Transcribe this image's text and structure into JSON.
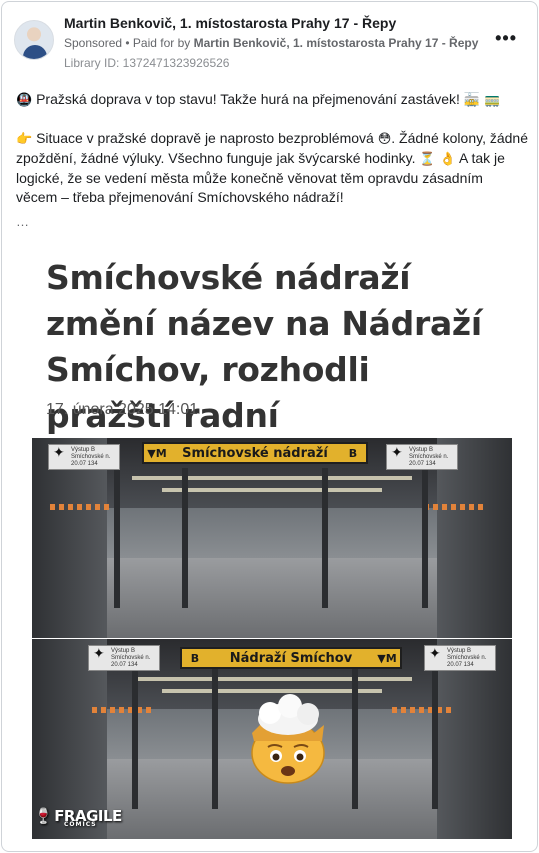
{
  "post": {
    "page_name": "Martin Benkovič, 1. místostarosta Prahy 17 - Řepy",
    "sponsored_label": "Sponsored",
    "separator": " • ",
    "paid_for_prefix": "Paid for by ",
    "paid_for_by": "Martin Benkovič, 1. místostarosta Prahy 17 - Řepy",
    "library_id": "Library ID: 1372471323926526",
    "more_label": "•••",
    "paragraph_1": "Pražská doprava v top stavu! Takže hurá na přejmenování zastávek!",
    "paragraph_1_emoji_start": "🚇",
    "paragraph_1_emoji_end": "🚋 🚃",
    "paragraph_2_a": "Situace v pražské dopravě je naprosto bezproblémová",
    "paragraph_2_b": ". Žádné kolony, žádné zpoždění, žádné výluky. Všechno funguje jak švýcarské hodinky.",
    "paragraph_2_c": " A tak je logické, že se vedení města může konečně věnovat těm opravdu zásadním věcem – třeba přejmenování Smíchovského nádraží!",
    "paragraph_2_emoji_start": "👉",
    "paragraph_2_emoji_mid": "😳",
    "paragraph_2_emoji_end": "⏳ 👌",
    "see_more": "…"
  },
  "media": {
    "headline": "Smíchovské nádraží změní název na Nádraží Smíchov, rozhodli pražští radní",
    "date": "17. února 2025  14:01",
    "top_sign": "Smíchovské nádraží",
    "top_sign_left": "▼M",
    "top_sign_right": "B",
    "bottom_sign": "Nádraží Smíchov",
    "bottom_sign_left": "B",
    "bottom_sign_right": "▼M",
    "plate_text": "Výstup B Smíchovské n. 20.07 134",
    "brand": "FRAGILE",
    "brand_sub": "COMICS"
  },
  "colors": {
    "sign_yellow": "#e2b12c",
    "text_primary": "#1c1e21",
    "text_secondary": "#65676b"
  }
}
